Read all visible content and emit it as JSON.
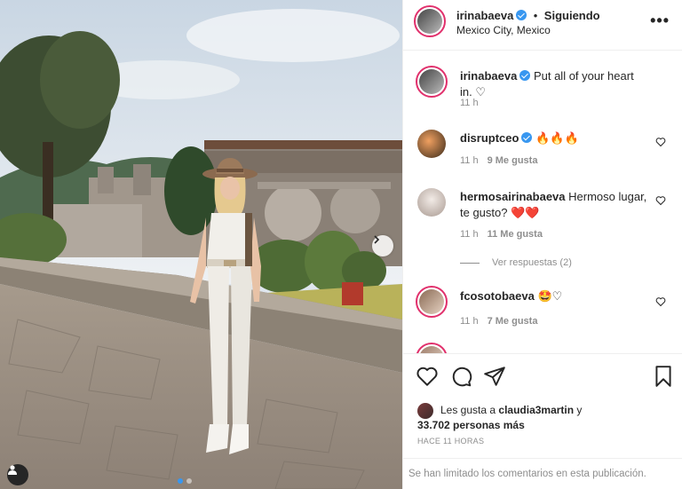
{
  "post": {
    "username": "irinabaeva",
    "follow_status": "Siguiendo",
    "location": "Mexico City, Mexico",
    "more_label": "•••"
  },
  "comments": [
    {
      "username": "irinabaeva",
      "verified": true,
      "text": "Put all of your heart in. ♡",
      "time": "11 h",
      "likes": ""
    },
    {
      "username": "disruptceo",
      "verified": true,
      "text": "🔥🔥🔥",
      "time": "11 h",
      "likes": "9 Me gusta"
    },
    {
      "username": "hermosairinabaeva",
      "verified": false,
      "text": "Hermoso lugar, te gusto? ❤️❤️",
      "time": "11 h",
      "likes": "11 Me gusta"
    },
    {
      "username": "fcosotobaeva",
      "verified": false,
      "text": "🤩♡",
      "time": "11 h",
      "likes": "7 Me gusta"
    }
  ],
  "replies_label": "Ver respuestas (2)",
  "likes": {
    "prefix": "Les gusta a ",
    "user": "claudia3martin",
    "middle": " y",
    "count": "33.702 personas más"
  },
  "timestamp": "HACE 11 HORAS",
  "restricted_text": "Se han limitado los comentarios en esta publicación.",
  "colors": {
    "accent": "#3897f0",
    "ring": "#e1306c",
    "muted": "#8e8e8e"
  }
}
